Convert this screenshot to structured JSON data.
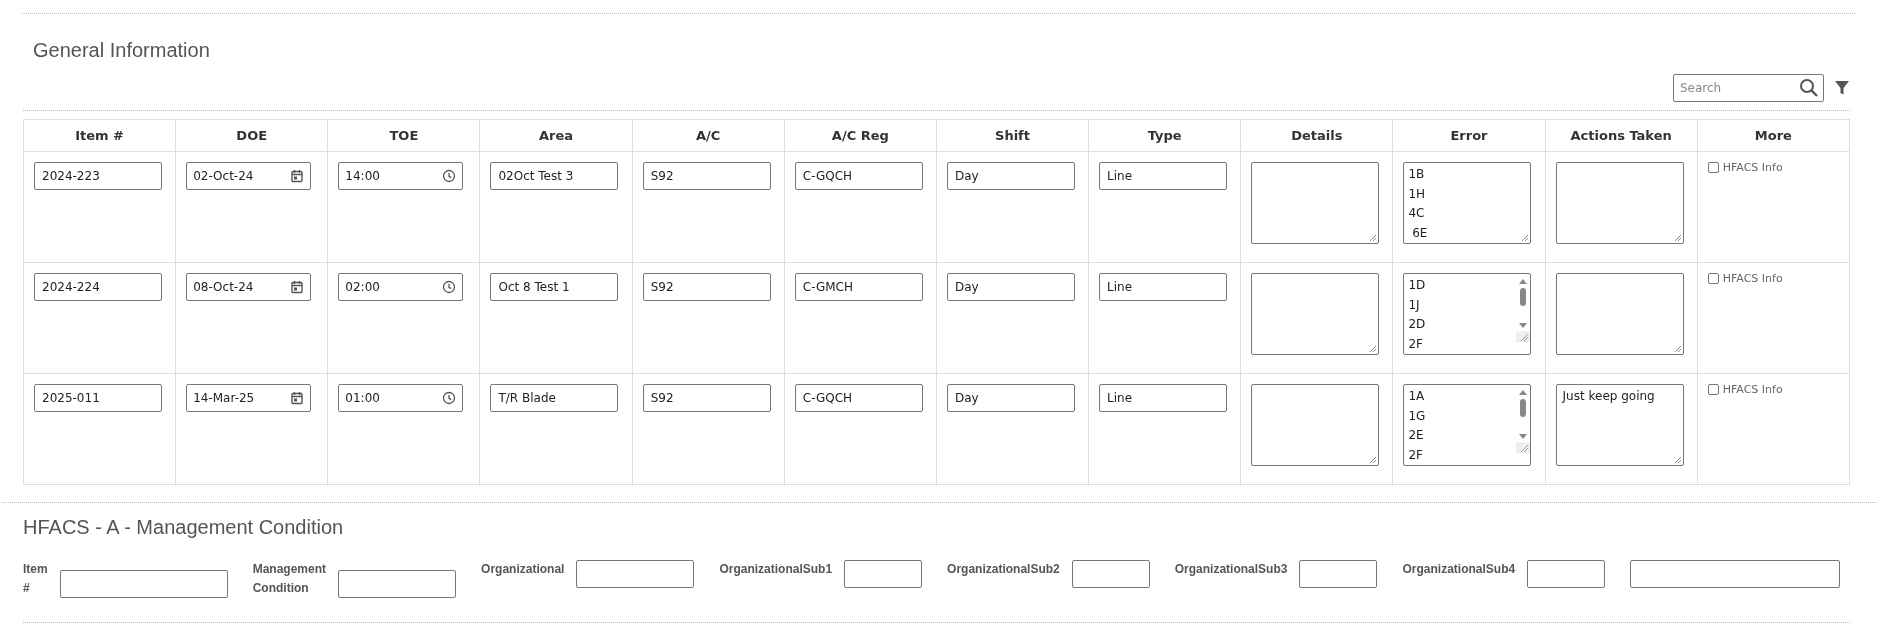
{
  "section_title": "General Information",
  "search": {
    "placeholder": "Search"
  },
  "table": {
    "columns": [
      "Item #",
      "DOE",
      "TOE",
      "Area",
      "A/C",
      "A/C Reg",
      "Shift",
      "Type",
      "Details",
      "Error",
      "Actions Taken",
      "More"
    ],
    "rows": [
      {
        "item": "2024-223",
        "doe": "02-Oct-24",
        "toe": "14:00",
        "area": "02Oct Test 3",
        "ac": "S92",
        "ac_reg": "C-GQCH",
        "shift": "Day",
        "type": "Line",
        "error": {
          "options": [
            "1B",
            "1H",
            "4C",
            " 6E"
          ],
          "scrollbar": false
        },
        "more": {
          "label": "HFACS Info",
          "checked": false
        }
      },
      {
        "item": "2024-224",
        "doe": "08-Oct-24",
        "toe": "02:00",
        "area": "Oct 8 Test 1",
        "ac": "S92",
        "ac_reg": "C-GMCH",
        "shift": "Day",
        "type": "Line",
        "error": {
          "options": [
            "1D",
            "1J",
            "2D",
            "2F"
          ],
          "scrollbar": true
        },
        "more": {
          "label": "HFACS Info",
          "checked": false
        }
      },
      {
        "item": "2025-011",
        "doe": "14-Mar-25",
        "toe": "01:00",
        "area": "T/R Blade",
        "ac": "S92",
        "ac_reg": "C-GQCH",
        "shift": "Day",
        "type": "Line",
        "error": {
          "options": [
            "1A",
            "1G",
            "2E",
            "2F"
          ],
          "scrollbar": true
        },
        "actions": "Just keep going",
        "more": {
          "label": "HFACS Info",
          "checked": false
        }
      }
    ]
  },
  "hfacs": {
    "title": "HFACS - A - Management Condition",
    "fields": [
      {
        "label": "Item #",
        "kind": "long"
      },
      {
        "label": "Management Condition",
        "kind": "medium"
      },
      {
        "label": "Organizational",
        "kind": "medium"
      },
      {
        "label": "OrganizationalSub1",
        "kind": "short"
      },
      {
        "label": "OrganizationalSub2",
        "kind": "short"
      },
      {
        "label": "OrganizationalSub3",
        "kind": "short"
      },
      {
        "label": "OrganizationalSub4",
        "kind": "short"
      },
      {
        "kind": "wide"
      }
    ]
  }
}
